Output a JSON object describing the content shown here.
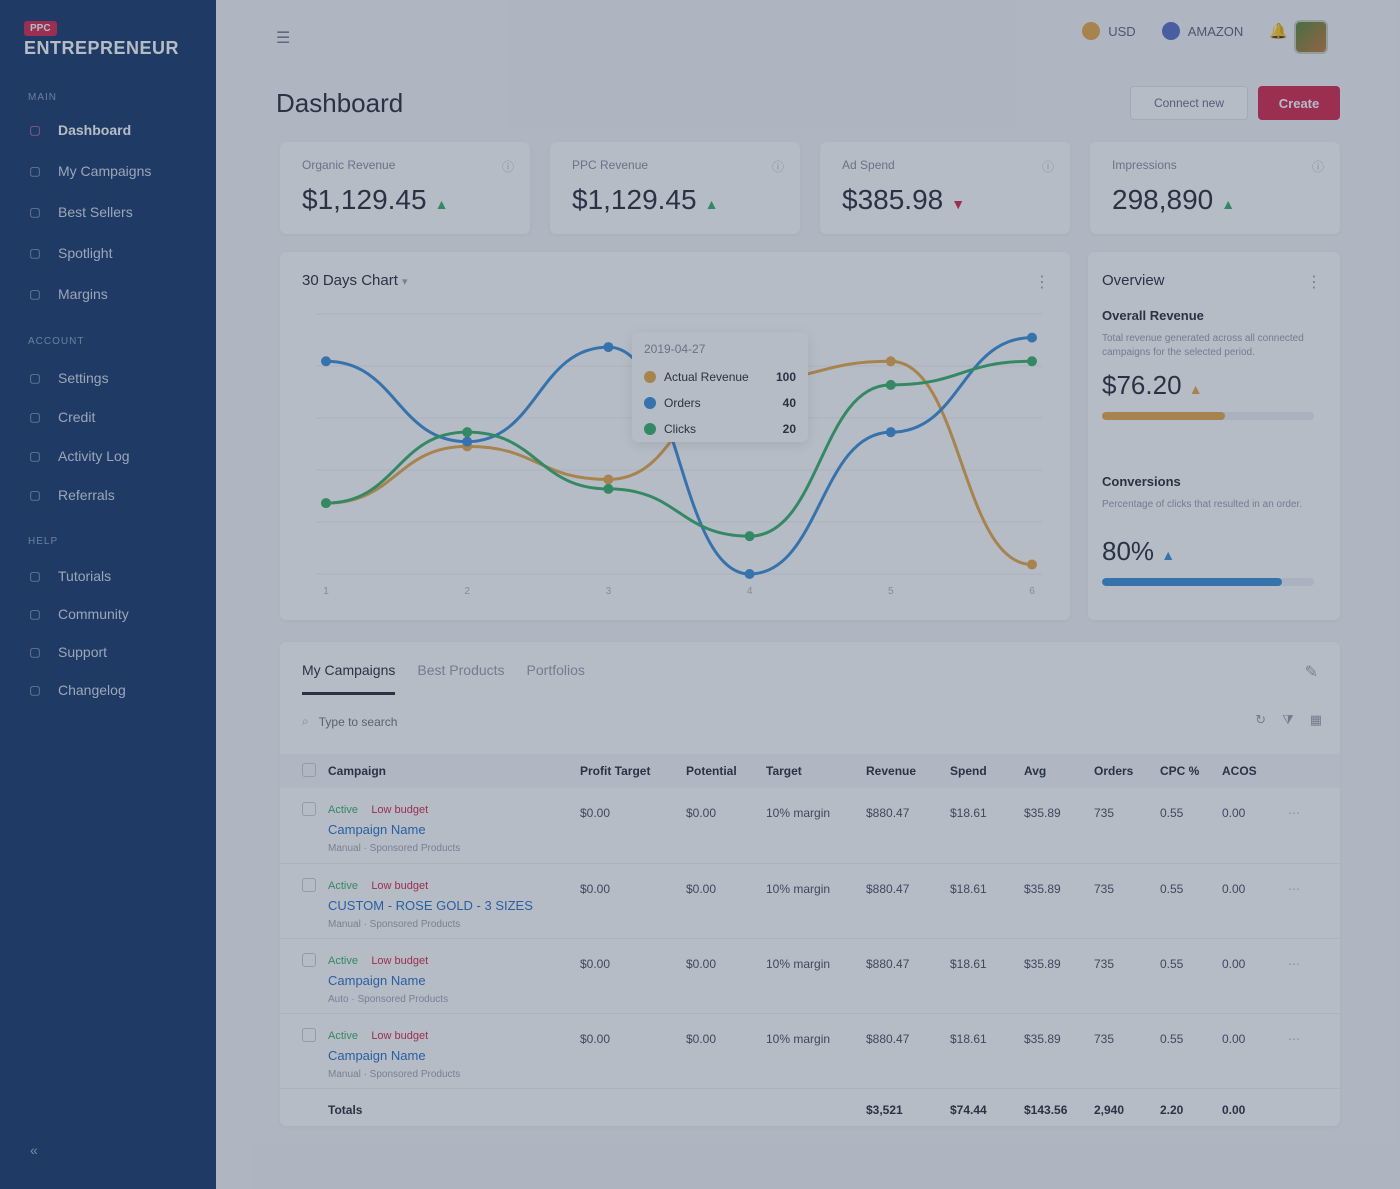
{
  "brand": {
    "badge": "PPC",
    "name": "ENTREPRENEUR"
  },
  "sidebar": {
    "sections": [
      {
        "title": "Main",
        "items": [
          {
            "label": "Dashboard",
            "icon": "dashboard-icon",
            "active": true
          },
          {
            "label": "My Campaigns",
            "icon": "campaigns-icon"
          },
          {
            "label": "Best Sellers",
            "icon": "bestsellers-icon"
          },
          {
            "label": "Spotlight",
            "icon": "spotlight-icon"
          },
          {
            "label": "Margins",
            "icon": "margins-icon"
          }
        ]
      },
      {
        "title": "Account",
        "items": [
          {
            "label": "Settings",
            "icon": "settings-icon"
          },
          {
            "label": "Credit",
            "icon": "credit-icon"
          },
          {
            "label": "Activity Log",
            "icon": "activity-icon"
          },
          {
            "label": "Referrals",
            "icon": "referrals-icon"
          }
        ]
      },
      {
        "title": "Help",
        "items": [
          {
            "label": "Tutorials",
            "icon": "tutorials-icon"
          },
          {
            "label": "Community",
            "icon": "community-icon"
          },
          {
            "label": "Support",
            "icon": "support-icon"
          },
          {
            "label": "Changelog",
            "icon": "changelog-icon"
          }
        ]
      }
    ]
  },
  "topbar": {
    "currency": "USD",
    "marketplace": "AMAZON"
  },
  "page": {
    "title": "Dashboard",
    "secondary_button": "Connect new",
    "primary_button": "Create"
  },
  "kpis": [
    {
      "label": "Organic Revenue",
      "value": "$1,129.45",
      "trend": "up",
      "color": "#3bb26b"
    },
    {
      "label": "PPC Revenue",
      "value": "$1,129.45",
      "trend": "up",
      "color": "#3bb26b"
    },
    {
      "label": "Ad Spend",
      "value": "$385.98",
      "trend": "down",
      "color": "#d6294f"
    },
    {
      "label": "Impressions",
      "value": "298,890",
      "trend": "up",
      "color": "#3bb26b"
    }
  ],
  "chart": {
    "title": "30 Days Chart",
    "tooltip": {
      "date": "2019-04-27",
      "rows": [
        {
          "name": "Actual Revenue",
          "value": "100",
          "color": "#e8a94a"
        },
        {
          "name": "Orders",
          "value": "40",
          "color": "#3d8fd8"
        },
        {
          "name": "Clicks",
          "value": "20",
          "color": "#3bb26b"
        }
      ]
    }
  },
  "chart_data": {
    "type": "line",
    "title": "30 Days Chart",
    "x": [
      "1",
      "2",
      "3",
      "4",
      "5",
      "6"
    ],
    "series": [
      {
        "name": "Actual Revenue",
        "color": "#e8a94a",
        "values": [
          15,
          27,
          20,
          41,
          45,
          2
        ]
      },
      {
        "name": "Orders",
        "color": "#3d8fd8",
        "values": [
          45,
          28,
          48,
          0,
          30,
          50
        ]
      },
      {
        "name": "Clicks",
        "color": "#3bb26b",
        "values": [
          15,
          30,
          18,
          8,
          40,
          45
        ]
      }
    ],
    "ylim": [
      0,
      55
    ],
    "grid": true,
    "legend": "tooltip"
  },
  "overview": {
    "title": "Overview",
    "blocks": [
      {
        "title": "Overall Revenue",
        "desc": "Total revenue generated across all connected campaigns for the selected period.",
        "value": "$76.20",
        "fill": 0.58,
        "color": "#e8a94a"
      },
      {
        "title": "Conversions",
        "desc": "Percentage of clicks that resulted in an order.",
        "value": "80%",
        "fill": 0.85,
        "color": "#3d8fd8"
      }
    ]
  },
  "campaigns": {
    "tabs": [
      "My Campaigns",
      "Best Products",
      "Portfolios"
    ],
    "search_placeholder": "Type to search",
    "columns": [
      "Campaign",
      "Profit Target",
      "Potential",
      "Target",
      "Revenue",
      "Spend",
      "Avg",
      "Orders",
      "CPC %",
      "ACOS"
    ],
    "rows": [
      {
        "status": "Active",
        "budget": "Low budget",
        "name": "Campaign Name",
        "meta": "Manual · Sponsored Products",
        "profit": "$0.00",
        "potential": "$0.00",
        "target": "10% margin",
        "revenue": "$880.47",
        "spend": "$18.61",
        "avg": "$35.89",
        "orders": "735",
        "cpc": "0.55",
        "acos": "0.00"
      },
      {
        "status": "Active",
        "budget": "Low budget",
        "name": "CUSTOM - ROSE GOLD - 3 SIZES",
        "meta": "Manual · Sponsored Products",
        "profit": "$0.00",
        "potential": "$0.00",
        "target": "10% margin",
        "revenue": "$880.47",
        "spend": "$18.61",
        "avg": "$35.89",
        "orders": "735",
        "cpc": "0.55",
        "acos": "0.00"
      },
      {
        "status": "Active",
        "budget": "Low budget",
        "name": "Campaign Name",
        "meta": "Auto · Sponsored Products",
        "profit": "$0.00",
        "potential": "$0.00",
        "target": "10% margin",
        "revenue": "$880.47",
        "spend": "$18.61",
        "avg": "$35.89",
        "orders": "735",
        "cpc": "0.55",
        "acos": "0.00"
      },
      {
        "status": "Active",
        "budget": "Low budget",
        "name": "Campaign Name",
        "meta": "Manual · Sponsored Products",
        "profit": "$0.00",
        "potential": "$0.00",
        "target": "10% margin",
        "revenue": "$880.47",
        "spend": "$18.61",
        "avg": "$35.89",
        "orders": "735",
        "cpc": "0.55",
        "acos": "0.00"
      }
    ],
    "totals": {
      "label": "Totals",
      "revenue": "$3,521",
      "spend": "$74.44",
      "avg": "$143.56",
      "orders": "2,940",
      "cpc": "2.20",
      "acos": "0.00"
    }
  }
}
